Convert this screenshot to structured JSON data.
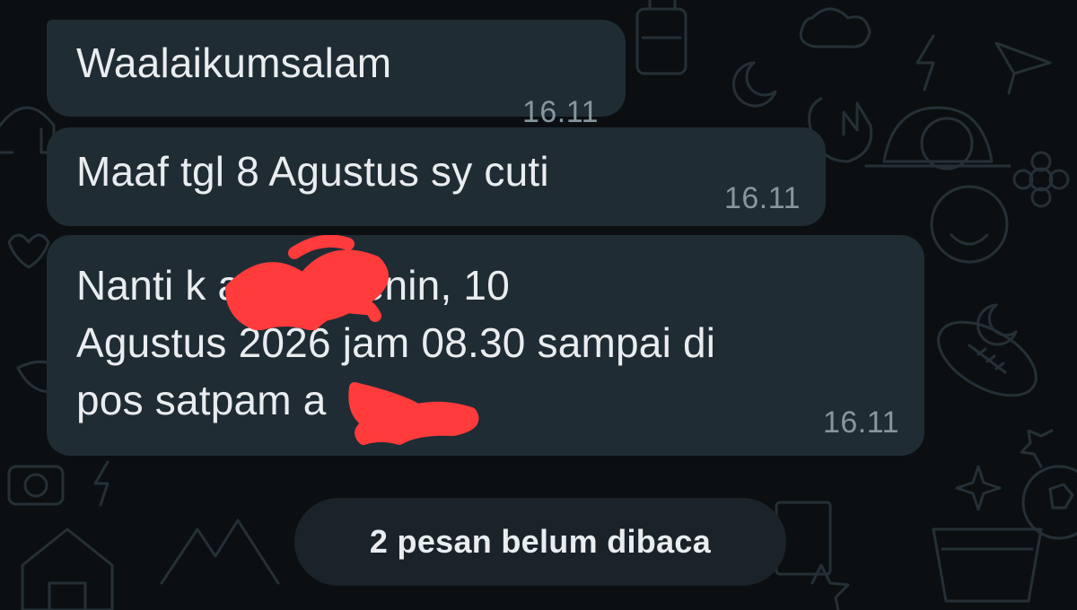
{
  "messages": [
    {
      "text": "Waalaikumsalam",
      "time": "16.11"
    },
    {
      "text": "Maaf tgl 8 Agustus sy cuti",
      "time": "16.11"
    },
    {
      "text": "Nanti k          a hari Senin, 10\nAgustus 2026 jam 08.30 sampai di\npos satpam a",
      "time": "16.11"
    }
  ],
  "unread_banner": "2 pesan belum dibaca",
  "colors": {
    "background": "#0b0f12",
    "bubble": "#1f2c34",
    "text": "#e9edef",
    "timestamp": "#8696a0",
    "redaction": "#ff3b3b"
  },
  "icons": [
    "chat-wallpaper-doodle-icons"
  ]
}
